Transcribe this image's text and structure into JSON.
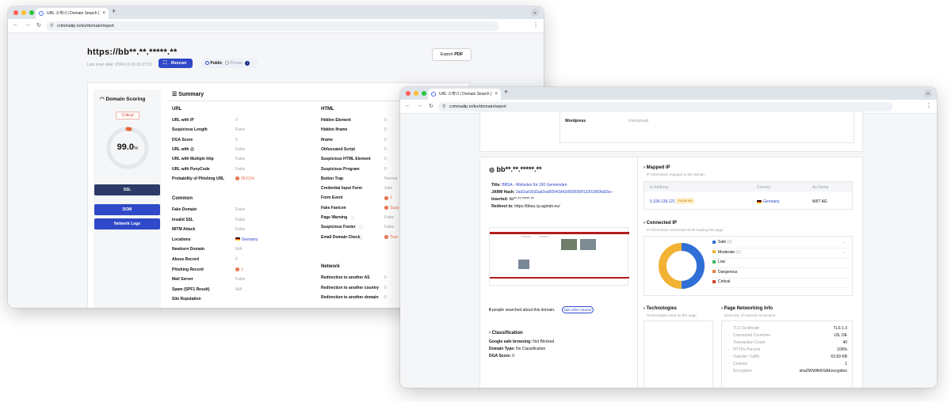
{
  "browser": {
    "tab_title": "URL 스캐너 | Domain Search |",
    "url": "criminalip.io/ko/domain/report",
    "colors": {
      "tabbar": "#dfe3ea",
      "close": "#ff5f57",
      "min": "#febc2e",
      "max": "#28c840"
    }
  },
  "win1": {
    "domain": "https://bb**.**.*****.**",
    "scan_date": "Last scan date: 2024-12-18 16:27:20",
    "rescan_label": "Rescan",
    "public_label": "Public",
    "private_label": "Private",
    "export_label": "Export",
    "export_pdf": "PDF",
    "domain_scoring": {
      "title": "Domain Scoring",
      "badge": "Critical",
      "score": "99.0",
      "unit": "%",
      "score_value": 99.0,
      "buttons": [
        "SSL",
        "DOM",
        "Network Logs"
      ]
    },
    "summary_title": "Summary",
    "url_section": {
      "title": "URL",
      "rows": [
        {
          "label": "URL with IP",
          "value": "0"
        },
        {
          "label": "Suspicious Length",
          "value": "False"
        },
        {
          "label": "DGA Score",
          "value": "0"
        },
        {
          "label": "URL with @",
          "value": "False"
        },
        {
          "label": "URL with Multiple http",
          "value": "False"
        },
        {
          "label": "URL with PunyCode",
          "value": "False"
        },
        {
          "label": "Probability of Phishing URL",
          "value": "99.61%"
        }
      ]
    },
    "common_section": {
      "title": "Common",
      "rows": [
        {
          "label": "Fake Domain",
          "value": "False"
        },
        {
          "label": "Invalid SSL",
          "value": "False"
        },
        {
          "label": "MITM Attack",
          "value": "False"
        },
        {
          "label": "Locations",
          "value": "Germany"
        },
        {
          "label": "Newborn Domain",
          "value": "N/A"
        },
        {
          "label": "Abuse Record",
          "value": "0"
        },
        {
          "label": "Phishing Record",
          "value": "1"
        },
        {
          "label": "Mail Server",
          "value": "False"
        },
        {
          "label": "Spam (SPF1 Result)",
          "value": "N/A"
        },
        {
          "label": "Site Reputation",
          "value": ""
        }
      ]
    },
    "html_section": {
      "title": "HTML",
      "rows": [
        {
          "label": "Hidden Element",
          "value": "0"
        },
        {
          "label": "Hidden Iframe",
          "value": "0"
        },
        {
          "label": "Iframe",
          "value": "0"
        },
        {
          "label": "Obfuscated Script",
          "value": "0"
        },
        {
          "label": "Suspicious HTML Element",
          "value": "0"
        },
        {
          "label": "Suspicious Program",
          "value": "0"
        },
        {
          "label": "Button Trap",
          "value": "Normal"
        },
        {
          "label": "Credential Input Form",
          "value": "Safe"
        },
        {
          "label": "Form Event",
          "value": "1"
        },
        {
          "label": "Fake Favicon",
          "value": "Susp"
        },
        {
          "label": "Page Warning",
          "value": "False"
        },
        {
          "label": "Suspicious Footer",
          "value": "False"
        },
        {
          "label": "Email Domain Check",
          "value": "True"
        }
      ]
    },
    "network_section": {
      "title": "Network",
      "rows": [
        {
          "label": "Redirection to another AS",
          "value": "0"
        },
        {
          "label": "Redirection to another country",
          "value": "0"
        },
        {
          "label": "Redirection to another domain",
          "value": "0"
        }
      ]
    }
  },
  "win2": {
    "wordpress_label": "Wordpress",
    "wordpress_value": "Unexposed",
    "domain": "bb**.**.*****.**",
    "info": [
      {
        "label": "Title:",
        "value": "BBSA - Websites für 190 Gemeinden",
        "link": true
      },
      {
        "label": "JARM Hash:",
        "value": "2ad2ad16d2ad2ad00042d42d000000f13301960fa83a--",
        "link": true
      },
      {
        "label": "Inserted:",
        "value": "bb**.**.*****.**",
        "link": false
      },
      {
        "label": "Redirect to:",
        "value": "https://bbsa.cp.agindo.eu/",
        "link": false
      }
    ],
    "searched_count": "6",
    "searched_text": "people searched about this domain.",
    "see_reports": "See other reports",
    "classification": {
      "title": "Classification",
      "rows": [
        {
          "label": "Google safe browsing:",
          "value": "Not Blocked"
        },
        {
          "label": "Domain Type:",
          "value": "No Classification"
        },
        {
          "label": "DGA Score:",
          "value": "0"
        }
      ]
    },
    "mapped_ip": {
      "title": "Mapped IP",
      "subtitle": "IP information mapped to the domain",
      "headers": [
        "Ip Address",
        "Country",
        "As Name"
      ],
      "ip": "5.199.138.121",
      "badge": "moderate",
      "country": "Germany",
      "as_name": "WIIT AG"
    },
    "connected_ip": {
      "title": "Connected IP",
      "subtitle": "IP information connected while loading this page",
      "legend": [
        {
          "label": "Safe",
          "count": "(1)",
          "color": "#2f6fd6"
        },
        {
          "label": "Moderate",
          "count": "(1)",
          "color": "#f2b233"
        },
        {
          "label": "Low",
          "color": "#3db55a"
        },
        {
          "label": "Dangerous",
          "color": "#e8823e"
        },
        {
          "label": "Critical",
          "color": "#d8432e"
        }
      ],
      "donut_values": [
        1,
        1
      ]
    },
    "technologies": {
      "title": "Technologies",
      "subtitle": "Technologies used by this page"
    },
    "networking": {
      "title": "Page Networking Info",
      "subtitle": "Summary of network connection",
      "rows": [
        {
          "label": "TLS Certificate",
          "value": "TLS 1.3"
        },
        {
          "label": "Connected Countries",
          "value": "US, DE"
        },
        {
          "label": "Transaction Count",
          "value": "40"
        },
        {
          "label": "HTTPs Percent",
          "value": "100%"
        },
        {
          "label": "Transfer Traffic",
          "value": "63.59 KB"
        },
        {
          "label": "Cookies",
          "value": "1"
        },
        {
          "label": "Encryption",
          "value": "sha256WithRSAEncryption"
        }
      ]
    }
  }
}
